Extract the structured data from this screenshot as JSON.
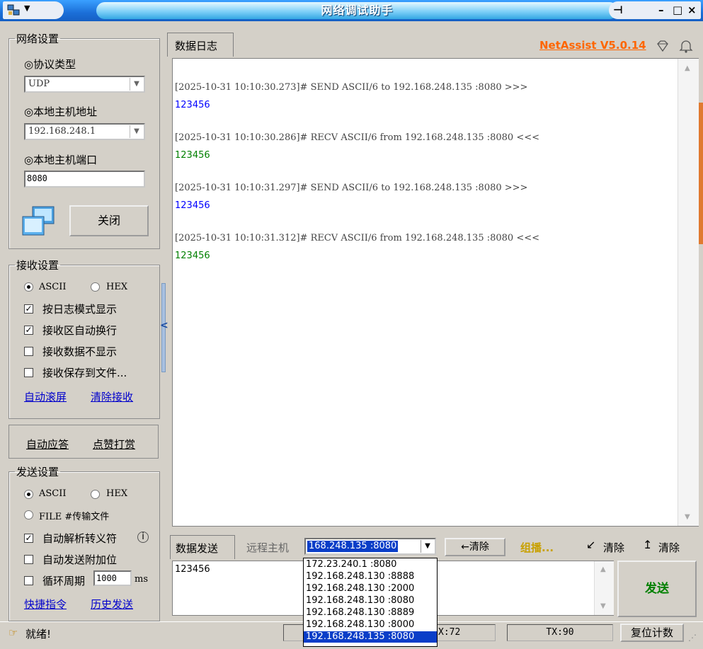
{
  "window": {
    "title": "网络调试助手",
    "version_link": "NetAssist V5.0.14"
  },
  "network": {
    "group_label": "网络设置",
    "protocol_label": "◎协议类型",
    "protocol_value": "UDP",
    "host_label": "◎本地主机地址",
    "host_value": "192.168.248.1",
    "port_label": "◎本地主机端口",
    "port_value": "8080",
    "close_button": "关闭"
  },
  "receive": {
    "group_label": "接收设置",
    "ascii": "ASCII",
    "hex": "HEX",
    "mode": "ASCII",
    "options": [
      {
        "label": "按日志模式显示",
        "checked": true
      },
      {
        "label": "接收区自动换行",
        "checked": true
      },
      {
        "label": "接收数据不显示",
        "checked": false
      },
      {
        "label": "接收保存到文件...",
        "checked": false
      }
    ],
    "auto_scroll": "自动滚屏",
    "clear_receive": "清除接收"
  },
  "extra": {
    "auto_reply": "自动应答",
    "like": "点赞打赏"
  },
  "send": {
    "group_label": "发送设置",
    "ascii": "ASCII",
    "hex": "HEX",
    "file": "FILE #传输文件",
    "mode": "ASCII",
    "options": [
      {
        "label": "自动解析转义符",
        "checked": true
      },
      {
        "label": "自动发送附加位",
        "checked": false
      },
      {
        "label": "循环周期",
        "checked": false
      }
    ],
    "period_value": "1000",
    "period_unit": "ms",
    "shortcut": "快捷指令",
    "history": "历史发送"
  },
  "log": {
    "tab_label": "数据日志",
    "entries": [
      {
        "header": "[2025-10-31 10:10:30.273]# SEND ASCII/6 to 192.168.248.135 :8080 >>>",
        "data": "123456",
        "dir": "send"
      },
      {
        "header": "[2025-10-31 10:10:30.286]# RECV ASCII/6 from 192.168.248.135 :8080 <<<",
        "data": "123456",
        "dir": "recv"
      },
      {
        "header": "[2025-10-31 10:10:31.297]# SEND ASCII/6 to 192.168.248.135 :8080 >>>",
        "data": "123456",
        "dir": "send"
      },
      {
        "header": "[2025-10-31 10:10:31.312]# RECV ASCII/6 from 192.168.248.135 :8080 <<<",
        "data": "123456",
        "dir": "recv"
      }
    ]
  },
  "sendbar": {
    "tab_label": "数据发送",
    "remote_label": "远程主机",
    "remote_value": "168.248.135 :8080",
    "clear_button": "←清除",
    "multicast": "组播...",
    "clear1": "清除",
    "clear2": "清除",
    "send_text": "123456",
    "send_button": "发送"
  },
  "remote_options": [
    "172.23.240.1 :8080",
    "192.168.248.130 :8888",
    "192.168.248.130 :2000",
    "192.168.248.130 :8080",
    "192.168.248.130 :8889",
    "192.168.248.130 :8000",
    "192.168.248.135 :8080"
  ],
  "status": {
    "ready": "就绪!",
    "rx": "X:72",
    "tx": "TX:90",
    "reset": "复位计数"
  },
  "colors": {
    "send": "#0000ff",
    "recv": "#008000",
    "version": "#ff6600",
    "selected": "#0a3ec8"
  }
}
